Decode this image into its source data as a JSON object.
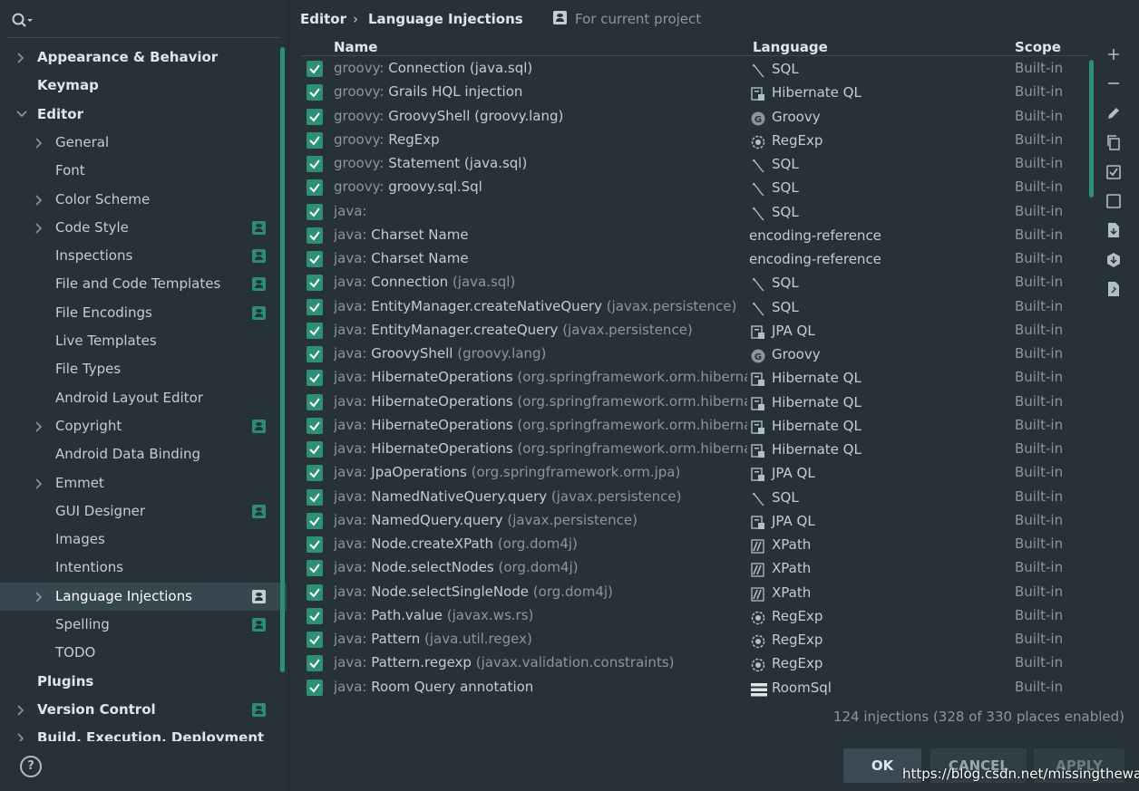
{
  "sidebar": {
    "search_icon": "search-icon",
    "items": [
      {
        "label": "Appearance & Behavior",
        "level": 0,
        "arrow": true,
        "expanded": false,
        "bold": true,
        "proj": false
      },
      {
        "label": "Keymap",
        "level": 0,
        "arrow": false,
        "bold": true,
        "proj": false
      },
      {
        "label": "Editor",
        "level": 0,
        "arrow": true,
        "expanded": true,
        "bold": true,
        "proj": false
      },
      {
        "label": "General",
        "level": 1,
        "arrow": true,
        "proj": false
      },
      {
        "label": "Font",
        "level": 1,
        "arrow": false,
        "proj": false
      },
      {
        "label": "Color Scheme",
        "level": 1,
        "arrow": true,
        "proj": false
      },
      {
        "label": "Code Style",
        "level": 1,
        "arrow": true,
        "proj": true
      },
      {
        "label": "Inspections",
        "level": 1,
        "arrow": false,
        "proj": true
      },
      {
        "label": "File and Code Templates",
        "level": 1,
        "arrow": false,
        "proj": true
      },
      {
        "label": "File Encodings",
        "level": 1,
        "arrow": false,
        "proj": true
      },
      {
        "label": "Live Templates",
        "level": 1,
        "arrow": false,
        "proj": false
      },
      {
        "label": "File Types",
        "level": 1,
        "arrow": false,
        "proj": false
      },
      {
        "label": "Android Layout Editor",
        "level": 1,
        "arrow": false,
        "proj": false
      },
      {
        "label": "Copyright",
        "level": 1,
        "arrow": true,
        "proj": true
      },
      {
        "label": "Android Data Binding",
        "level": 1,
        "arrow": false,
        "proj": false
      },
      {
        "label": "Emmet",
        "level": 1,
        "arrow": true,
        "proj": false
      },
      {
        "label": "GUI Designer",
        "level": 1,
        "arrow": false,
        "proj": true
      },
      {
        "label": "Images",
        "level": 1,
        "arrow": false,
        "proj": false
      },
      {
        "label": "Intentions",
        "level": 1,
        "arrow": false,
        "proj": false
      },
      {
        "label": "Language Injections",
        "level": 1,
        "arrow": true,
        "proj": true,
        "selected": true
      },
      {
        "label": "Spelling",
        "level": 1,
        "arrow": false,
        "proj": true
      },
      {
        "label": "TODO",
        "level": 1,
        "arrow": false,
        "proj": false
      },
      {
        "label": "Plugins",
        "level": 0,
        "arrow": false,
        "bold": true,
        "proj": false
      },
      {
        "label": "Version Control",
        "level": 0,
        "arrow": true,
        "bold": true,
        "proj": true
      },
      {
        "label": "Build, Execution, Deployment",
        "level": 0,
        "arrow": true,
        "bold": true,
        "proj": false
      }
    ],
    "help_label": "?"
  },
  "breadcrumb": {
    "parent": "Editor",
    "separator": "›",
    "current": "Language Injections",
    "scope_label": "For current project"
  },
  "table": {
    "columns": {
      "name": "Name",
      "language": "Language",
      "scope": "Scope"
    },
    "rows": [
      {
        "prefix": "groovy:",
        "main": "Connection (java.sql)",
        "pkg": "",
        "lang": "SQL",
        "icon": "sql",
        "scope": "Built-in"
      },
      {
        "prefix": "groovy:",
        "main": "Grails HQL injection",
        "pkg": "",
        "lang": "Hibernate QL",
        "icon": "hql",
        "scope": "Built-in"
      },
      {
        "prefix": "groovy:",
        "main": "GroovyShell (groovy.lang)",
        "pkg": "",
        "lang": "Groovy",
        "icon": "groovy",
        "scope": "Built-in"
      },
      {
        "prefix": "groovy:",
        "main": "RegExp",
        "pkg": "",
        "lang": "RegExp",
        "icon": "regexp",
        "scope": "Built-in"
      },
      {
        "prefix": "groovy:",
        "main": "Statement (java.sql)",
        "pkg": "",
        "lang": "SQL",
        "icon": "sql",
        "scope": "Built-in"
      },
      {
        "prefix": "groovy:",
        "main": "groovy.sql.Sql",
        "pkg": "",
        "lang": "SQL",
        "icon": "sql",
        "scope": "Built-in"
      },
      {
        "prefix": "java:",
        "main": "",
        "pkg": "",
        "lang": "SQL",
        "icon": "sql",
        "scope": "Built-in"
      },
      {
        "prefix": "java:",
        "main": "Charset Name",
        "pkg": "",
        "lang": "encoding-reference",
        "icon": "",
        "scope": "Built-in"
      },
      {
        "prefix": "java:",
        "main": "Charset Name",
        "pkg": "",
        "lang": "encoding-reference",
        "icon": "",
        "scope": "Built-in"
      },
      {
        "prefix": "java:",
        "main": "Connection",
        "pkg": "(java.sql)",
        "lang": "SQL",
        "icon": "sql",
        "scope": "Built-in"
      },
      {
        "prefix": "java:",
        "main": "EntityManager.createNativeQuery",
        "pkg": "(javax.persistence)",
        "lang": "SQL",
        "icon": "sql",
        "scope": "Built-in"
      },
      {
        "prefix": "java:",
        "main": "EntityManager.createQuery",
        "pkg": "(javax.persistence)",
        "lang": "JPA QL",
        "icon": "hql",
        "scope": "Built-in"
      },
      {
        "prefix": "java:",
        "main": "GroovyShell",
        "pkg": "(groovy.lang)",
        "lang": "Groovy",
        "icon": "groovy",
        "scope": "Built-in"
      },
      {
        "prefix": "java:",
        "main": "HibernateOperations",
        "pkg": "(org.springframework.orm.hibernate",
        "lang": "Hibernate QL",
        "icon": "hql",
        "scope": "Built-in"
      },
      {
        "prefix": "java:",
        "main": "HibernateOperations",
        "pkg": "(org.springframework.orm.hibernate",
        "lang": "Hibernate QL",
        "icon": "hql",
        "scope": "Built-in"
      },
      {
        "prefix": "java:",
        "main": "HibernateOperations",
        "pkg": "(org.springframework.orm.hibernate",
        "lang": "Hibernate QL",
        "icon": "hql",
        "scope": "Built-in"
      },
      {
        "prefix": "java:",
        "main": "HibernateOperations",
        "pkg": "(org.springframework.orm.hibernate",
        "lang": "Hibernate QL",
        "icon": "hql",
        "scope": "Built-in"
      },
      {
        "prefix": "java:",
        "main": "JpaOperations",
        "pkg": "(org.springframework.orm.jpa)",
        "lang": "JPA QL",
        "icon": "hql",
        "scope": "Built-in"
      },
      {
        "prefix": "java:",
        "main": "NamedNativeQuery.query",
        "pkg": "(javax.persistence)",
        "lang": "SQL",
        "icon": "sql",
        "scope": "Built-in"
      },
      {
        "prefix": "java:",
        "main": "NamedQuery.query",
        "pkg": "(javax.persistence)",
        "lang": "JPA QL",
        "icon": "hql",
        "scope": "Built-in"
      },
      {
        "prefix": "java:",
        "main": "Node.createXPath",
        "pkg": "(org.dom4j)",
        "lang": "XPath",
        "icon": "xpath",
        "scope": "Built-in"
      },
      {
        "prefix": "java:",
        "main": "Node.selectNodes",
        "pkg": "(org.dom4j)",
        "lang": "XPath",
        "icon": "xpath",
        "scope": "Built-in"
      },
      {
        "prefix": "java:",
        "main": "Node.selectSingleNode",
        "pkg": "(org.dom4j)",
        "lang": "XPath",
        "icon": "xpath",
        "scope": "Built-in"
      },
      {
        "prefix": "java:",
        "main": "Path.value",
        "pkg": "(javax.ws.rs)",
        "lang": "RegExp",
        "icon": "regexp",
        "scope": "Built-in"
      },
      {
        "prefix": "java:",
        "main": "Pattern",
        "pkg": "(java.util.regex)",
        "lang": "RegExp",
        "icon": "regexp",
        "scope": "Built-in"
      },
      {
        "prefix": "java:",
        "main": "Pattern.regexp",
        "pkg": "(javax.validation.constraints)",
        "lang": "RegExp",
        "icon": "regexp",
        "scope": "Built-in"
      },
      {
        "prefix": "java:",
        "main": "Room Query annotation",
        "pkg": "",
        "lang": "RoomSql",
        "icon": "roomsql",
        "scope": "Built-in"
      }
    ]
  },
  "toolbar": [
    "add-icon",
    "remove-icon",
    "edit-icon",
    "copy-icon",
    "enable-all-icon",
    "disable-all-icon",
    "import-icon",
    "export-icon",
    "file-icon"
  ],
  "status": "124 injections (328 of 330 places enabled)",
  "buttons": {
    "ok": "OK",
    "cancel": "CANCEL",
    "apply": "APPLY"
  },
  "watermark": "https://blog.csdn.net/missingtheway",
  "colors": {
    "accent": "#2d8f74",
    "background": "#263238",
    "selection": "#37474f"
  }
}
